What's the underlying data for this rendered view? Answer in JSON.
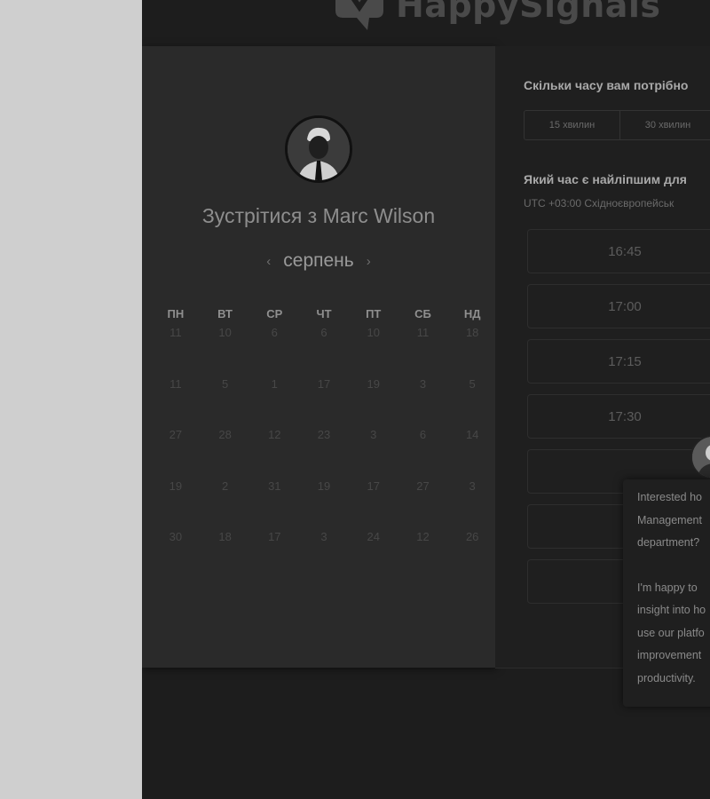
{
  "brand": {
    "name": "HappySignals"
  },
  "host": {
    "meet_title": "Зустрітися з Marc Wilson"
  },
  "calendar": {
    "prev_label": "‹",
    "next_label": "›",
    "month": "серпень",
    "weekdays": [
      "ПН",
      "ВТ",
      "СР",
      "ЧТ",
      "ПТ",
      "СБ",
      "НД"
    ],
    "weeks": [
      [
        "11",
        "10",
        "6",
        "6",
        "10",
        "11",
        "18"
      ],
      [
        "11",
        "5",
        "1",
        "17",
        "19",
        "3",
        "5"
      ],
      [
        "27",
        "28",
        "12",
        "23",
        "3",
        "6",
        "14"
      ],
      [
        "19",
        "2",
        "31",
        "19",
        "17",
        "27",
        "3"
      ],
      [
        "30",
        "18",
        "17",
        "3",
        "24",
        "12",
        "26"
      ]
    ]
  },
  "booking": {
    "duration_question": "Скільки часу вам потрібно",
    "durations": [
      "15 хвилин",
      "30 хвилин"
    ],
    "time_question": "Який час є найліпшим для",
    "timezone": "UTC +03:00 Східноєвропейськ",
    "slots": [
      "16:45",
      "17:00",
      "17:15",
      "17:30",
      "",
      "",
      ""
    ]
  },
  "chat": {
    "message_p1": "Interested ho\nManagement\ndepartment?",
    "message_p2": "I'm happy to\ninsight into ho\nuse our platfo\nimprovement\nproductivity."
  }
}
